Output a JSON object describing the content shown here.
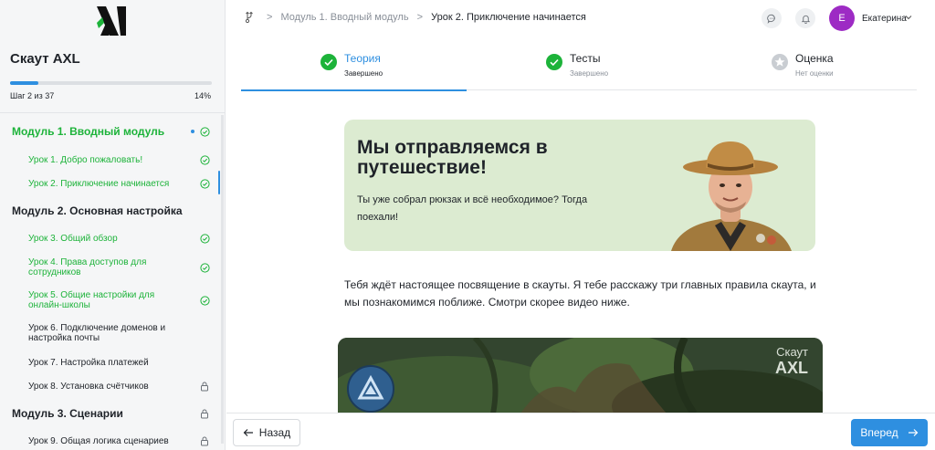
{
  "sidebar": {
    "course_title": "Скаут AXL",
    "step_text": "Шаг 2 из 37",
    "progress_percent_text": "14%",
    "progress_value": 0.14,
    "items": [
      {
        "type": "module",
        "label": "Модуль 1. Вводный модуль",
        "done": true,
        "current": true
      },
      {
        "type": "lesson",
        "label": "Урок 1. Добро пожаловать!",
        "status": "done"
      },
      {
        "type": "lesson",
        "label": "Урок 2. Приключение начинается",
        "status": "done",
        "active": true
      },
      {
        "type": "module",
        "label": "Модуль 2. Основная настройка",
        "done": false
      },
      {
        "type": "lesson",
        "label": "Урок 3. Общий обзор",
        "status": "done"
      },
      {
        "type": "lesson",
        "label": "Урок 4. Права доступов для сотрудников",
        "status": "done"
      },
      {
        "type": "lesson",
        "label": "Урок 5. Общие настройки для онлайн-школы",
        "status": "done"
      },
      {
        "type": "lesson",
        "label": "Урок 6. Подключение доменов и настройка почты",
        "status": "open"
      },
      {
        "type": "lesson",
        "label": "Урок 7. Настройка платежей",
        "status": "open"
      },
      {
        "type": "lesson",
        "label": "Урок 8. Установка счётчиков",
        "status": "locked"
      },
      {
        "type": "module",
        "label": "Модуль 3. Сценарии",
        "done": false,
        "locked": true
      },
      {
        "type": "lesson",
        "label": "Урок 9. Общая логика сценариев",
        "status": "locked"
      }
    ]
  },
  "header": {
    "breadcrumb": [
      "Модуль 1. Вводный модуль",
      "Урок 2. Приключение начинается"
    ],
    "user_initial": "E",
    "user_name": "Екатерина"
  },
  "tabs": [
    {
      "title": "Теория",
      "status": "Завершено",
      "state": "done",
      "active": true
    },
    {
      "title": "Тесты",
      "status": "Завершено",
      "state": "done",
      "active": false
    },
    {
      "title": "Оценка",
      "status": "Нет оценки",
      "state": "none",
      "active": false
    }
  ],
  "banner": {
    "title": "Мы отправляемся в путешествие!",
    "text": "Ты уже собрал рюкзак и всё необходимое? Тогда поехали!"
  },
  "intro_text": "Тебя ждёт настоящее посвящение в скауты. Я тебе расскажу три главных правила скаута, и мы познакомимся поближе. Смотри скорее видео ниже.",
  "video": {
    "logo_line1": "Скаут",
    "logo_line2": "AXL"
  },
  "footer": {
    "back_label": "Назад",
    "next_label": "Вперед"
  },
  "colors": {
    "accent": "#2e8fe0",
    "done": "#1db33a",
    "banner_bg": "#dcebd1",
    "avatar": "#9d2bc4"
  }
}
